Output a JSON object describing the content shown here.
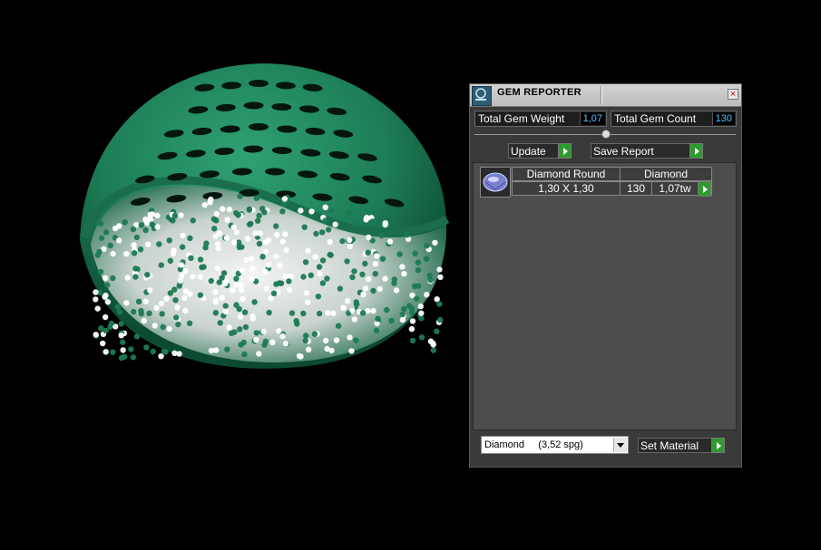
{
  "window": {
    "title": "GEM REPORTER",
    "close_glyph": "×"
  },
  "stats": {
    "total_weight_label": "Total Gem Weight",
    "total_weight_value": "1,07",
    "total_count_label": "Total Gem Count",
    "total_count_value": "130"
  },
  "buttons": {
    "update_label": "Update",
    "save_report_label": "Save Report",
    "set_material_label": "Set Material"
  },
  "gems": [
    {
      "icon": "diamond-gem-icon",
      "shape": "Diamond Round",
      "material": "Diamond",
      "size": "1,30 X 1,30",
      "count": "130",
      "weight": "1,07tw"
    }
  ],
  "material_select": {
    "selected": "Diamond     (3,52 spg)"
  },
  "colors": {
    "accent_blue": "#4fc6ff",
    "go_green": "#2e9b2e",
    "ring_green": "#1e7a55"
  }
}
